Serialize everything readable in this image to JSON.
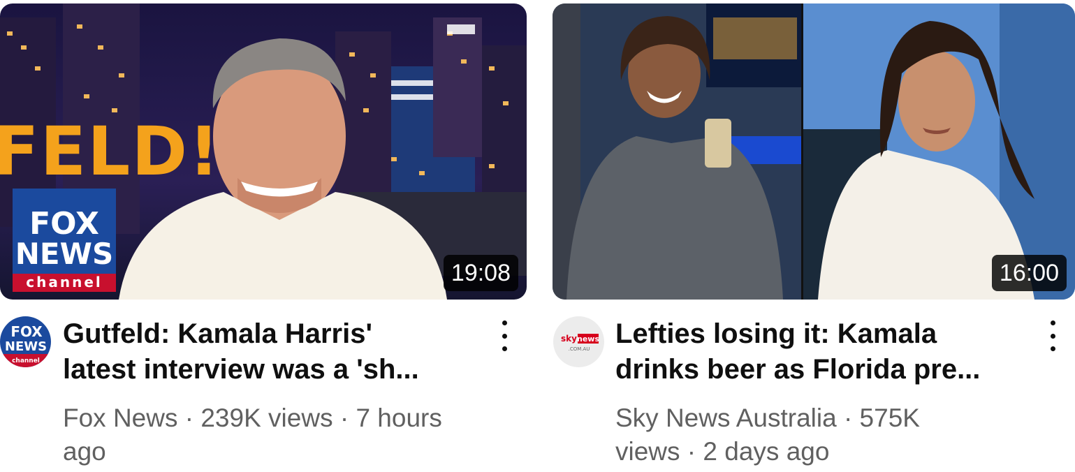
{
  "videos": [
    {
      "duration": "19:08",
      "title_line1": "Gutfeld: Kamala Harris'",
      "title_line2": "latest interview was a 'sh...",
      "meta_line1": "Fox News · 239K views · 7 hours",
      "meta_line2": "ago",
      "channel_logo": {
        "top": "FOX",
        "mid": "NEWS",
        "bottom": "channel"
      },
      "thumb_logo": {
        "top": "FOX",
        "mid": "NEWS",
        "bottom": "channel"
      },
      "thumb_bg_text": "FELD!"
    },
    {
      "duration": "16:00",
      "title_line1": "Lefties losing it: Kamala",
      "title_line2": "drinks beer as Florida pre...",
      "meta_line1": "Sky News Australia · 575K",
      "meta_line2": "views · 2 days ago",
      "channel_logo": {
        "sky": "sky",
        "news": "news",
        "domain": ".COM.AU"
      }
    }
  ],
  "icons": {
    "more": "more-vertical-icon"
  },
  "colors": {
    "title": "#0f0f0f",
    "meta": "#606060",
    "duration_bg": "#000000cc",
    "fox_blue": "#1b4a9e",
    "fox_red": "#c8102e",
    "sky_red": "#d6001c"
  }
}
